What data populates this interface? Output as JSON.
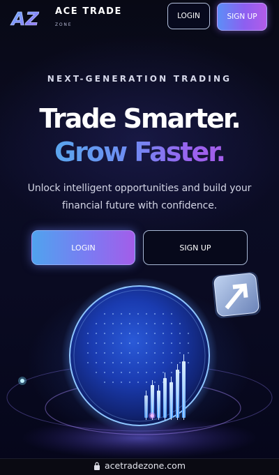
{
  "header": {
    "logo_text": "AZ",
    "brand_name": "ACE TRADE",
    "brand_sub": "ZONE",
    "login_label": "LOGIN",
    "signup_label": "SIGN UP"
  },
  "hero": {
    "eyebrow": "NEXT-GENERATION TRADING",
    "headline_line1": "Trade Smarter.",
    "headline_line2": "Grow Faster.",
    "subtitle": "Unlock intelligent opportunities and build your financial future with confidence.",
    "cta_login": "LOGIN",
    "cta_signup": "SIGN UP"
  },
  "illustration": {
    "globe": "trading-globe",
    "arrow_icon": "arrow-up-right-icon",
    "chart_icon": "bar-chart-icon"
  },
  "browser": {
    "url": "acetradezone.com",
    "lock_icon": "lock-icon"
  },
  "colors": {
    "background": "#07081a",
    "accent_blue": "#5ba6ee",
    "accent_purple": "#a35de9"
  }
}
